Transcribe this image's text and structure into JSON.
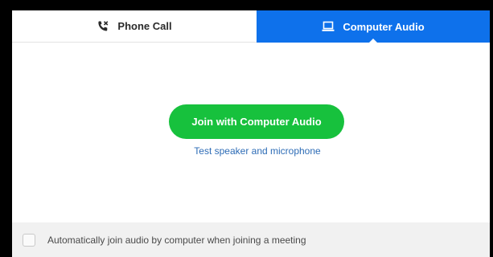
{
  "tabs": {
    "phone_call": {
      "label": "Phone Call",
      "icon": "phone-icon"
    },
    "computer_audio": {
      "label": "Computer Audio",
      "icon": "laptop-icon",
      "selected": true
    }
  },
  "main": {
    "join_button_label": "Join with Computer Audio",
    "test_link": "Test speaker and microphone"
  },
  "footer": {
    "auto_join_checked": false,
    "auto_join_label": "Automatically join audio by computer when joining a meeting"
  },
  "colors": {
    "accent_blue": "#0e71eb",
    "join_green": "#17c13d",
    "link_blue": "#2d6cb6"
  }
}
